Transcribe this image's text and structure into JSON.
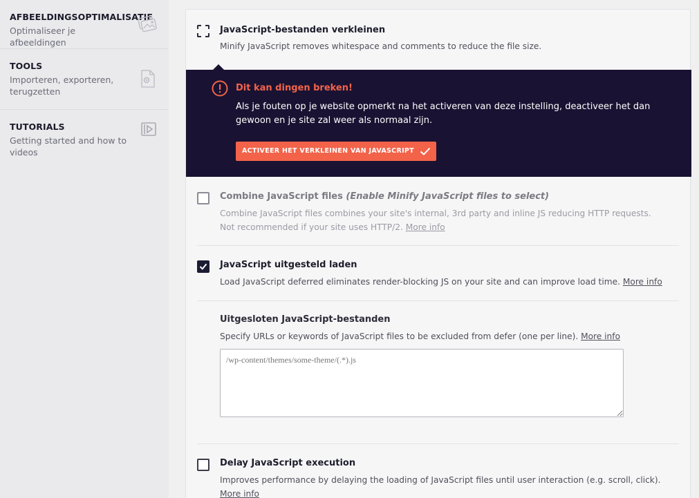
{
  "sidebar": {
    "items": [
      {
        "title": "AFBEELDINGSOPTIMALISATIE",
        "subtitle": "Optimaliseer je afbeeldingen",
        "icon": "image-optimization-icon"
      },
      {
        "title": "TOOLS",
        "subtitle": "Importeren, exporteren, terugzetten",
        "icon": "tools-file-icon"
      },
      {
        "title": "TUTORIALS",
        "subtitle": "Getting started and how to videos",
        "icon": "video-play-icon"
      }
    ]
  },
  "minify_js": {
    "label": "JavaScript-bestanden verkleinen",
    "description": "Minify JavaScript removes whitespace and comments to reduce the file size.",
    "state": "dashed"
  },
  "warning": {
    "title": "Dit kan dingen breken!",
    "text": "Als je fouten op je website opmerkt na het activeren van deze instelling, deactiveer het dan gewoon en je site zal weer als normaal zijn.",
    "button_label": "ACTIVEER HET VERKLEINEN VAN JAVASCRIPT",
    "accent_color": "#f2634a",
    "background_color": "#1a1232"
  },
  "combine_js": {
    "label": "Combine JavaScript files",
    "note": "(Enable Minify JavaScript files to select)",
    "description": "Combine JavaScript files combines your site's internal, 3rd party and inline JS reducing HTTP requests. Not recommended if your site uses HTTP/2.",
    "more_info": "More info",
    "checked": false,
    "disabled": true
  },
  "defer_js": {
    "label": "JavaScript uitgesteld laden",
    "description": "Load JavaScript deferred eliminates render-blocking JS on your site and can improve load time.",
    "more_info": "More info",
    "checked": true
  },
  "excluded_js": {
    "label": "Uitgesloten JavaScript-bestanden",
    "description": "Specify URLs or keywords of JavaScript files to be excluded from defer (one per line).",
    "more_info": "More info",
    "placeholder": "/wp-content/themes/some-theme/(.*).js"
  },
  "delay_js": {
    "label": "Delay JavaScript execution",
    "description": "Improves performance by delaying the loading of JavaScript files until user interaction (e.g. scroll, click).",
    "more_info": "More info",
    "checked": false
  }
}
